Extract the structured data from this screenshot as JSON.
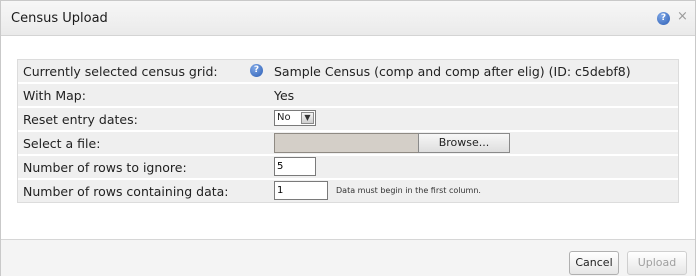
{
  "dialog": {
    "title": "Census Upload",
    "close_glyph": "×"
  },
  "icons": {
    "help": "help-icon",
    "close": "close-icon",
    "dropdown": "chevron-down-icon"
  },
  "form": {
    "census_grid": {
      "label": "Currently selected census grid:",
      "value": "Sample Census (comp and comp after elig) (ID: c5debf8)"
    },
    "with_map": {
      "label": "With Map:",
      "value": "Yes"
    },
    "reset_entry_dates": {
      "label": "Reset entry dates:",
      "selected": "No"
    },
    "select_file": {
      "label": "Select a file:",
      "browse_label": "Browse..."
    },
    "rows_to_ignore": {
      "label": "Number of rows to ignore:",
      "value": "5"
    },
    "rows_containing_data": {
      "label": "Number of rows containing data:",
      "value": "1",
      "hint": "Data must begin in the first column."
    }
  },
  "footer": {
    "cancel_label": "Cancel",
    "upload_label": "Upload"
  },
  "colors": {
    "row_background": "#efefef",
    "help_icon": "#2d5fb5"
  }
}
